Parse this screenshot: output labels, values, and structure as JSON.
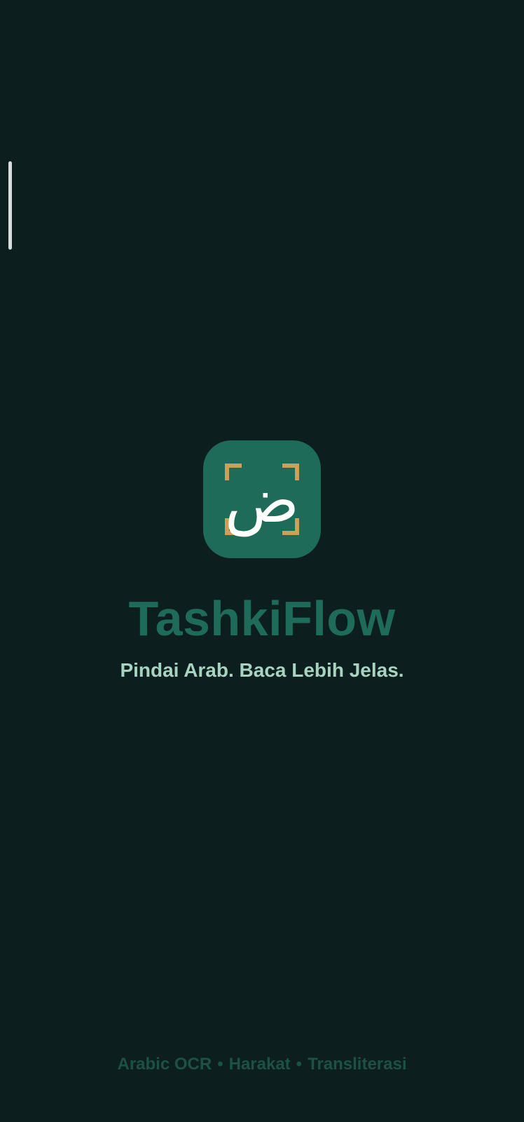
{
  "app": {
    "name": "TashkiFlow",
    "tagline": "Pindai Arab. Baca Lebih Jelas.",
    "icon_glyph": "ض",
    "icon_name": "arabic-scan-icon"
  },
  "features": {
    "items": [
      "Arabic OCR",
      "Harakat",
      "Transliterasi"
    ],
    "separator": "•"
  },
  "colors": {
    "background": "#0c1f1e",
    "brand": "#1f6b5a",
    "accent_frame": "#c9a15a",
    "tagline": "#a9d3c1",
    "footer": "#1d5146"
  }
}
